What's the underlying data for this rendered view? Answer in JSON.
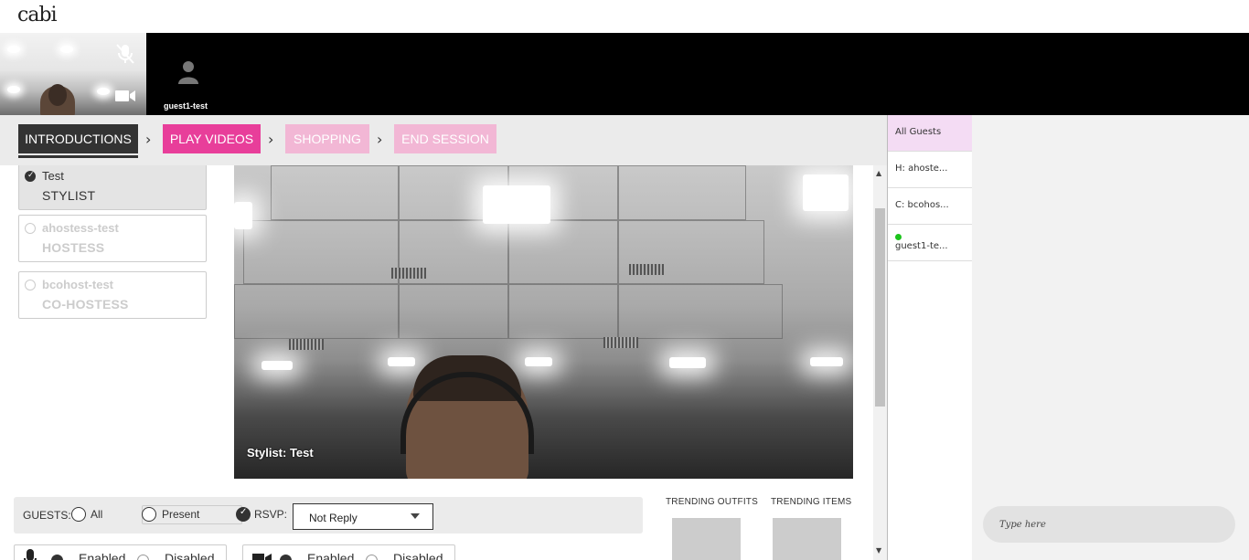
{
  "app": {
    "logo": "cabi"
  },
  "video_strip": {
    "self_tile": {
      "mic_icon": "mic-off-icon",
      "camera_icon": "camera-icon"
    },
    "guest_tile": {
      "name": "guest1-test",
      "avatar_icon": "person-icon"
    }
  },
  "steps": [
    {
      "label": "INTRODUCTIONS",
      "state": "active"
    },
    {
      "label": "PLAY VIDEOS",
      "state": "pink"
    },
    {
      "label": "SHOPPING",
      "state": "pale"
    },
    {
      "label": "END SESSION",
      "state": "pale"
    }
  ],
  "participants": [
    {
      "name": "Test",
      "role": "STYLIST",
      "selected": true
    },
    {
      "name": "ahostess-test",
      "role": "HOSTESS",
      "selected": false
    },
    {
      "name": "bcohost-test",
      "role": "CO-HOSTESS",
      "selected": false
    }
  ],
  "stage": {
    "caption": "Stylist: Test"
  },
  "guests_bar": {
    "label": "GUESTS:",
    "all_label": "All",
    "present_label": "Present",
    "rsvp_label": "RSVP:",
    "rsvp_value": "Not Reply"
  },
  "media_controls": {
    "mic": {
      "enabled_label": "Enabled",
      "disabled_label": "Disabled"
    },
    "camera": {
      "enabled_label": "Enabled",
      "disabled_label": "Disabled"
    }
  },
  "trending": {
    "outfits_label": "TRENDING OUTFITS",
    "items_label": "TRENDING ITEMS"
  },
  "guest_list": {
    "items": [
      {
        "label": "All Guests"
      },
      {
        "label": "H: ahoste..."
      },
      {
        "label": "C: bcohos..."
      },
      {
        "label": "guest1-te...",
        "online": true
      }
    ]
  },
  "chat": {
    "placeholder": "Type here"
  },
  "colors": {
    "active_step": "#333333",
    "pink": "#e83e9a",
    "pale_pink": "#f2b7d5",
    "online": "#1cc41c",
    "all_guests_bg": "#f4dcf4"
  }
}
